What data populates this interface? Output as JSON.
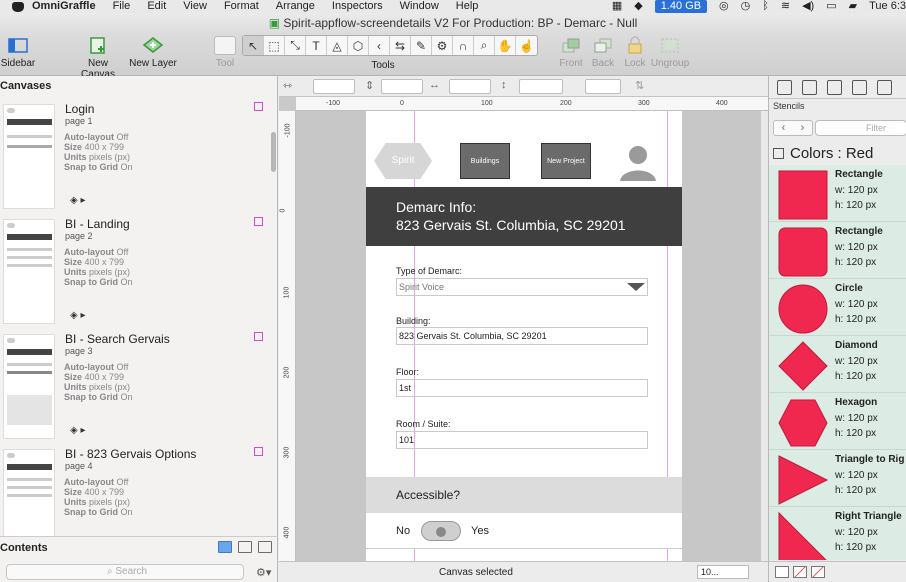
{
  "menubar": {
    "app": "OmniGraffle",
    "items": [
      "File",
      "Edit",
      "View",
      "Format",
      "Arrange",
      "Inspectors",
      "Window",
      "Help"
    ],
    "memory": "1.40 GB",
    "clock": "Tue 6:3"
  },
  "window": {
    "title": "Spirit-appflow-screendetails V2 For Production: BP - Demarc - Null"
  },
  "toolbar": {
    "sidebar": "Sidebar",
    "new_canvas": "New Canvas",
    "new_layer": "New Layer",
    "tool": "Tool",
    "tools": "Tools",
    "front": "Front",
    "back": "Back",
    "lock": "Lock",
    "ungroup": "Ungroup",
    "tool_glyphs": [
      "↖",
      "⬚",
      "⤡",
      "T",
      "◬",
      "⬡",
      "‹",
      "⇆",
      "✎",
      "⚙",
      "∩",
      "⌕",
      "✋",
      "☝"
    ]
  },
  "sidebar": {
    "heading": "Canvases",
    "canvases": [
      {
        "title": "Login",
        "page": "page 1",
        "autolayout_label": "Auto-layout",
        "autolayout": "Off",
        "size_label": "Size",
        "size": "400 x 799",
        "units_label": "Units",
        "units": "pixels (px)",
        "snap_label": "Snap to Grid",
        "snap": "On"
      },
      {
        "title": "BI - Landing",
        "page": "page 2",
        "autolayout_label": "Auto-layout",
        "autolayout": "Off",
        "size_label": "Size",
        "size": "400 x 799",
        "units_label": "Units",
        "units": "pixels (px)",
        "snap_label": "Snap to Grid",
        "snap": "On"
      },
      {
        "title": "BI - Search Gervais",
        "page": "page 3",
        "autolayout_label": "Auto-layout",
        "autolayout": "Off",
        "size_label": "Size",
        "size": "400 x 799",
        "units_label": "Units",
        "units": "pixels (px)",
        "snap_label": "Snap to Grid",
        "snap": "On"
      },
      {
        "title": "BI - 823 Gervais Options",
        "page": "page 4",
        "autolayout_label": "Auto-layout",
        "autolayout": "Off",
        "size_label": "Size",
        "size": "400 x 799",
        "units_label": "Units",
        "units": "pixels (px)",
        "snap_label": "Snap to Grid",
        "snap": "On"
      }
    ],
    "contents_heading": "Contents",
    "search_placeholder": "Search"
  },
  "rulers": {
    "h": [
      "-100",
      "0",
      "100",
      "200",
      "300",
      "400"
    ],
    "v": [
      "-100",
      "0",
      "100",
      "200",
      "300",
      "400"
    ]
  },
  "canvas": {
    "logo_label": "Spirit",
    "btn_buildings": "Buildings",
    "btn_new_project": "New Project",
    "header_line1": "Demarc Info:",
    "header_line2": "823 Gervais St. Columbia, SC 29201",
    "field_type_label": "Type of Demarc:",
    "field_type_value": "Spirit Voice",
    "field_building_label": "Building:",
    "field_building_value": "823 Gervais St. Columbia, SC 29201",
    "field_floor_label": "Floor:",
    "field_floor_value": "1st",
    "field_room_label": "Room / Suite:",
    "field_room_value": "101",
    "accessible_label": "Accessible?",
    "toggle_no": "No",
    "toggle_yes": "Yes",
    "status": "Canvas selected",
    "zoom": "10..."
  },
  "stencils": {
    "heading": "Stencils",
    "filter_placeholder": "Filter",
    "group_title": "Colors : Red",
    "shape_color": "#f0284f",
    "items": [
      {
        "name": "Rectangle",
        "w": "w: 120 px",
        "h": "h: 120 px",
        "shape": "rect"
      },
      {
        "name": "Rectangle",
        "w": "w: 120 px",
        "h": "h: 120 px",
        "shape": "roundrect"
      },
      {
        "name": "Circle",
        "w": "w: 120 px",
        "h": "h: 120 px",
        "shape": "circle"
      },
      {
        "name": "Diamond",
        "w": "w: 120 px",
        "h": "h: 120 px",
        "shape": "diamond"
      },
      {
        "name": "Hexagon",
        "w": "w: 120 px",
        "h": "h: 120 px",
        "shape": "hexagon"
      },
      {
        "name": "Triangle to Rig",
        "w": "w: 120 px",
        "h": "h: 120 px",
        "shape": "triangle-right"
      },
      {
        "name": "Right Triangle",
        "w": "w: 120 px",
        "h": "h: 120 px",
        "shape": "right-triangle"
      }
    ]
  }
}
